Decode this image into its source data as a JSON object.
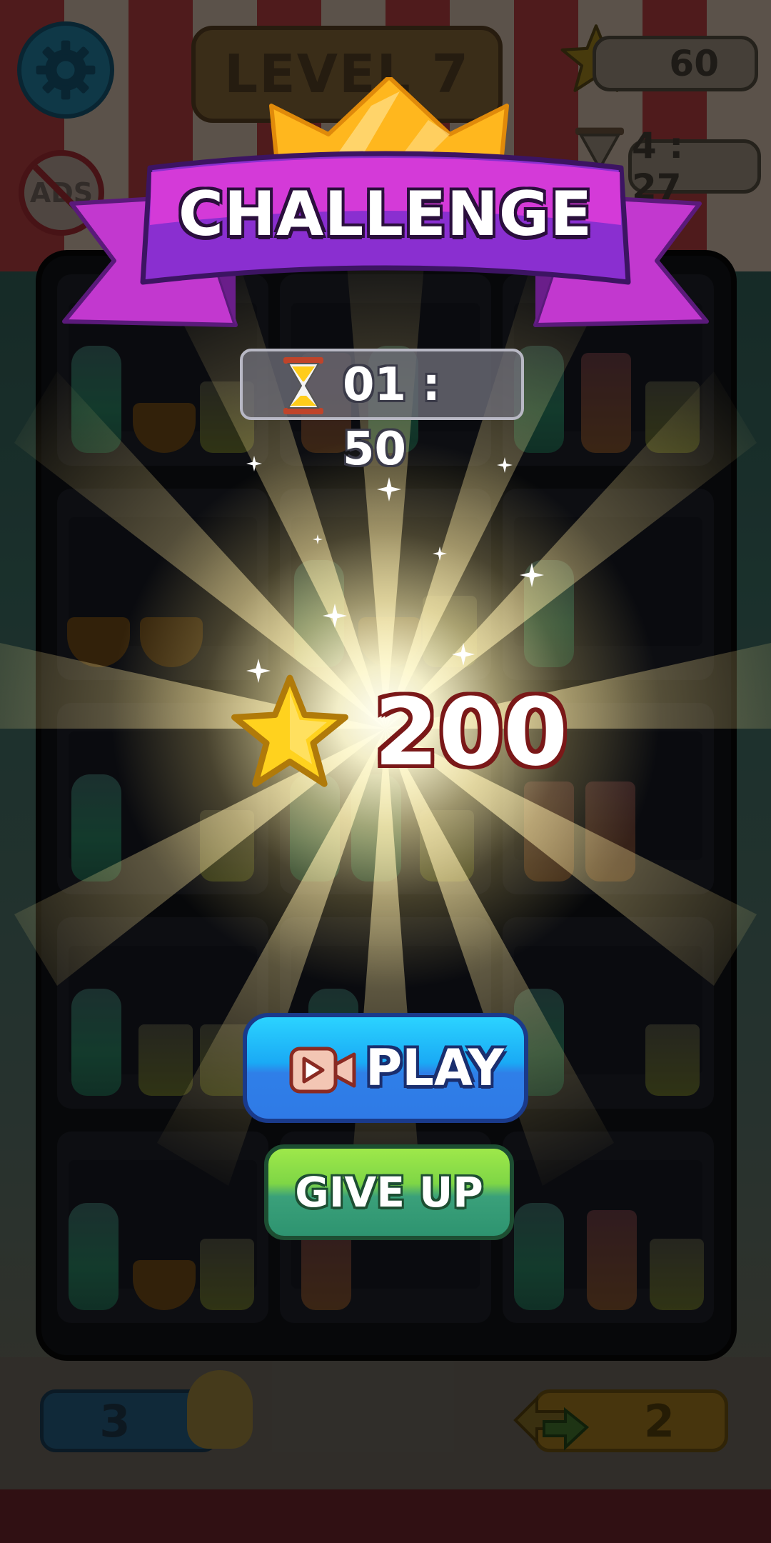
{
  "hud": {
    "level_label": "LEVEL 7",
    "star_count": "60",
    "time_remaining": "4 : 27",
    "ads_label": "ADS",
    "hint_count": "3",
    "shuffle_count": "2"
  },
  "popup": {
    "title": "CHALLENGE",
    "timer": "01 : 50",
    "reward_amount": "200",
    "play_label": "PLAY",
    "give_up_label": "GIVE UP"
  },
  "colors": {
    "ribbon_purple": "#8a2fd0",
    "ribbon_magenta": "#d43ad8",
    "crown_gold": "#ffb71e",
    "play_blue": "#1aaaf5",
    "give_up_green": "#7fd646",
    "reward_outline": "#7a1818",
    "star_yellow": "#ffd21e"
  },
  "icons": [
    "gear-icon",
    "no-ads-icon",
    "star-icon",
    "hourglass-icon",
    "video-icon",
    "lightbulb-icon",
    "shuffle-icon",
    "crown-icon"
  ]
}
